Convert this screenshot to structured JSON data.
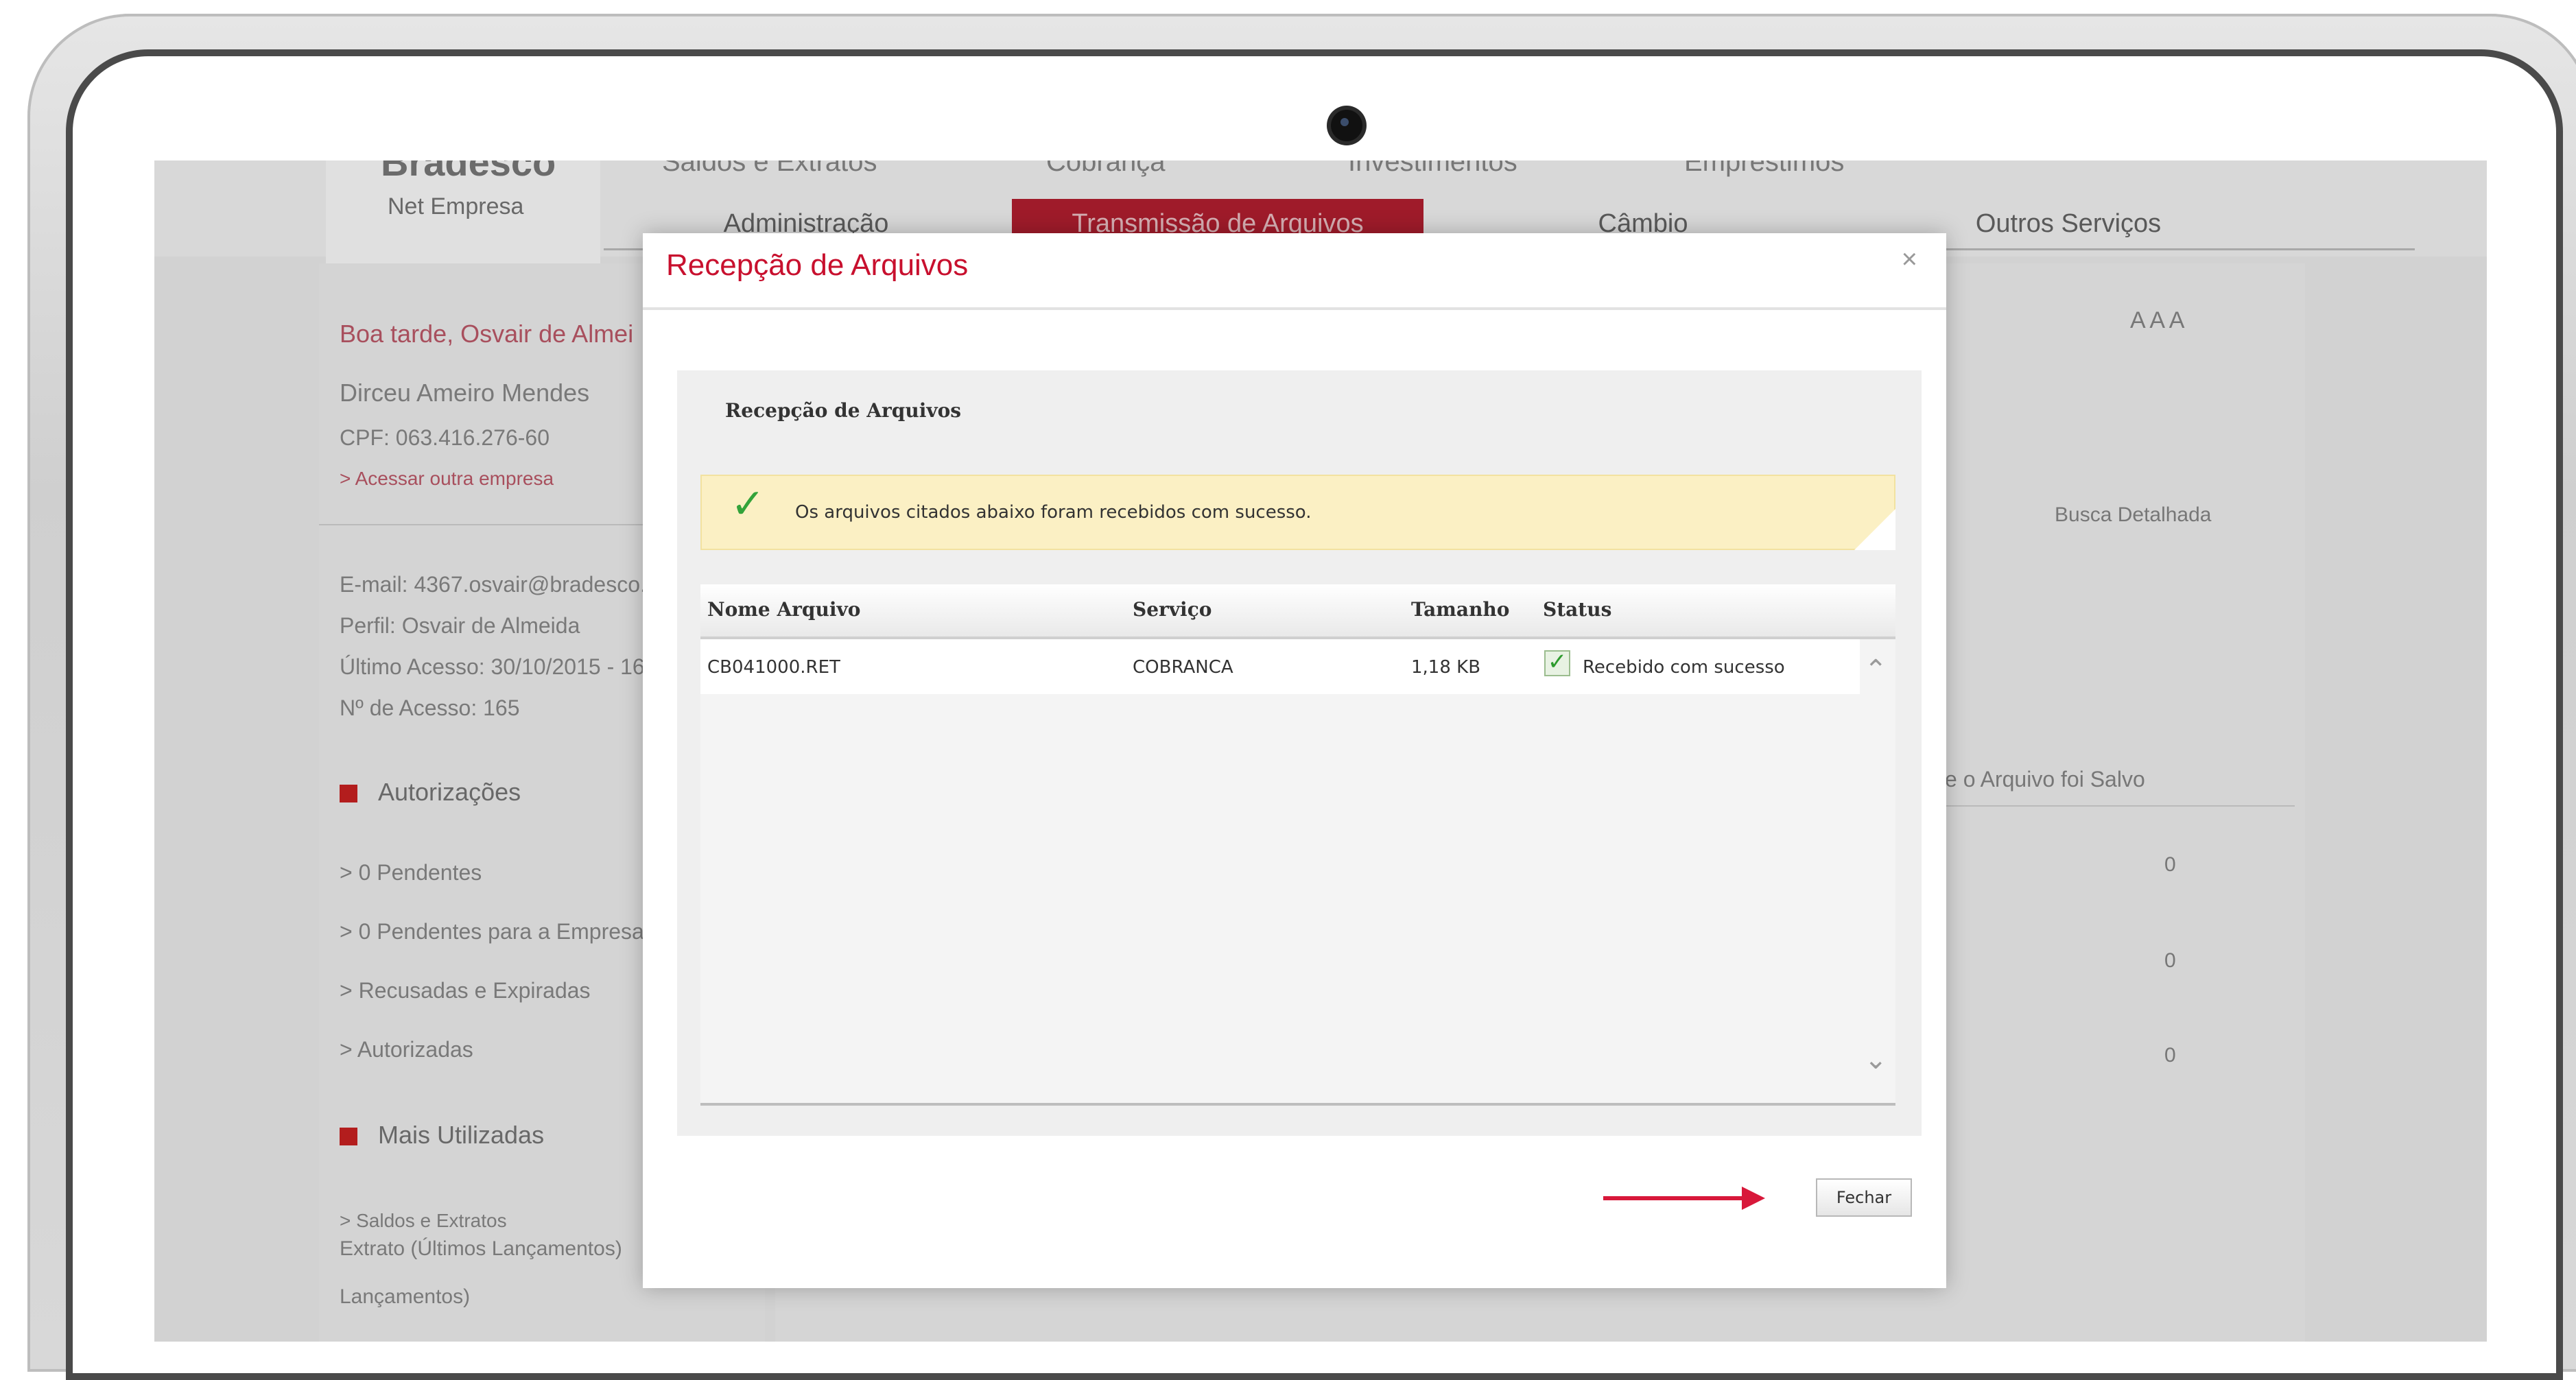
{
  "background_app": {
    "brand": "Bradesco",
    "brand_sub": "Net Empresa",
    "menu_top": [
      "Saldos e Extratos",
      "Cobrança",
      "Investimentos",
      "Empréstimos"
    ],
    "menu": [
      "Administração",
      "Transmissão de Arquivos",
      "Câmbio",
      "Outros Serviços"
    ],
    "greeting": "Boa tarde, Osvair de Almei",
    "user_name": "Dirceu Ameiro Mendes",
    "cpf": "CPF: 063.416.276-60",
    "access_other": "> Acessar outra empresa",
    "email": "E-mail: 4367.osvair@bradesco...",
    "profile": "Perfil: Osvair de Almeida",
    "last_access": "Último Acesso: 30/10/2015 - 16",
    "access_count": "Nº de Acesso: 165",
    "authorizations_title": "Autorizações",
    "authorizations": [
      "> 0 Pendentes",
      "> 0 Pendentes para a Empresa",
      "> Recusadas e Expiradas",
      "> Autorizadas"
    ],
    "most_used_title": "Mais Utilizadas",
    "most_used": [
      "> Saldos e Extratos",
      "Extrato (Últimos Lançamentos)",
      "Lançamentos)"
    ],
    "font_sizes": "A A A",
    "detailed_search": "Busca Detalhada",
    "saved_header": "e o Arquivo foi Salvo",
    "counts": [
      "0",
      "0",
      "0"
    ]
  },
  "modal": {
    "title": "Recepção de Arquivos",
    "close_glyph": "×",
    "panel_title": "Recepção de Arquivos",
    "notice": "Os arquivos citados abaixo foram recebidos com sucesso.",
    "columns": [
      "Nome Arquivo",
      "Serviço",
      "Tamanho",
      "Status"
    ],
    "rows": [
      {
        "file": "CB041000.RET",
        "service": "COBRANCA",
        "size": "1,18 KB",
        "status": "Recebido com sucesso"
      }
    ],
    "close_button": "Fechar"
  },
  "colors": {
    "accent_red": "#c8102e",
    "success_green": "#33a33a",
    "notice_bg": "#fbf0c4"
  }
}
